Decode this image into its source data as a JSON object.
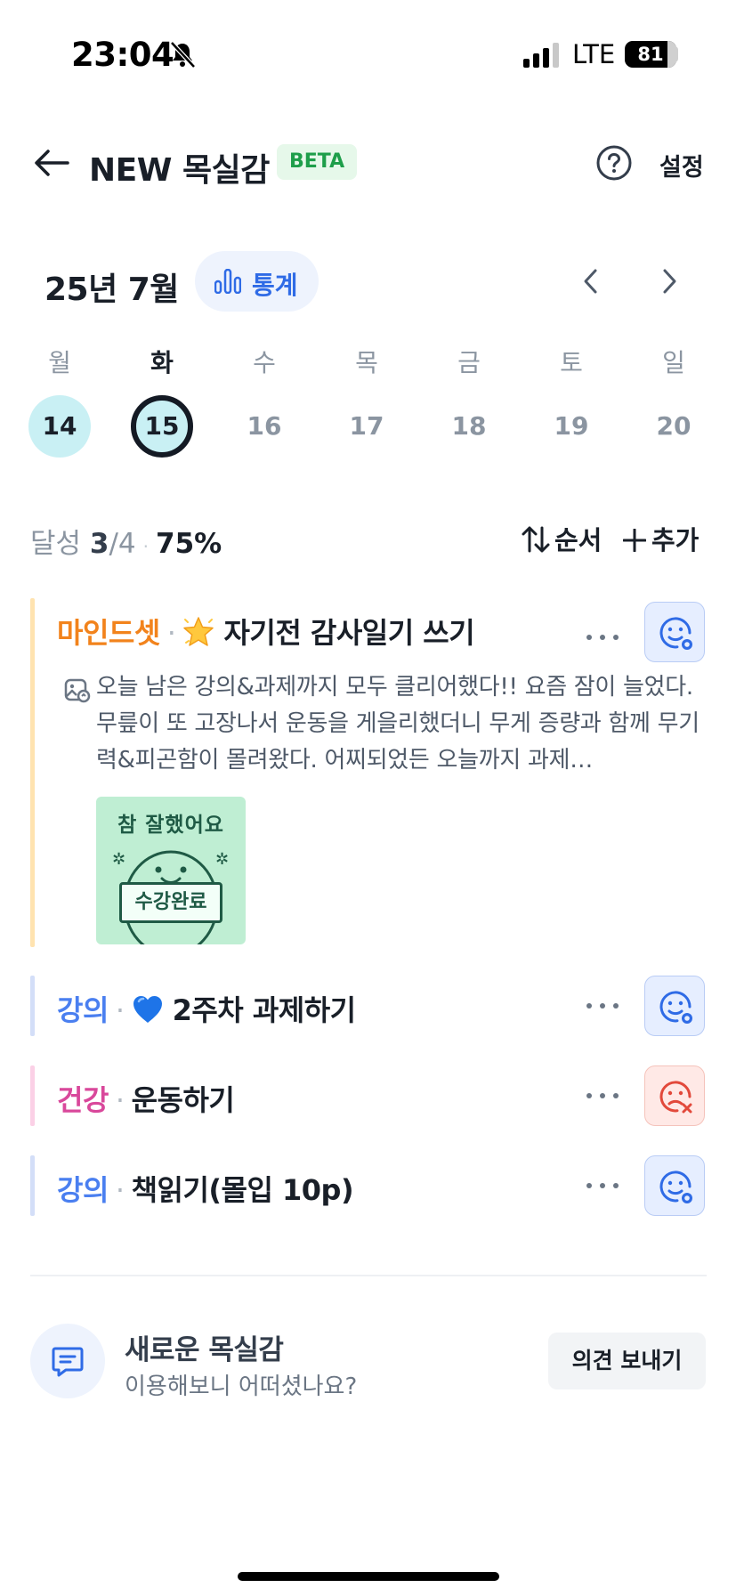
{
  "status_bar": {
    "time": "23:04",
    "network": "LTE",
    "battery": "81"
  },
  "header": {
    "title": "NEW 목실감",
    "badge": "BETA",
    "settings_label": "설정"
  },
  "calendar": {
    "month": "25년 7월",
    "stats_label": "통계",
    "weekdays": [
      "월",
      "화",
      "수",
      "목",
      "금",
      "토",
      "일"
    ],
    "dates": [
      "14",
      "15",
      "16",
      "17",
      "18",
      "19",
      "20"
    ],
    "today_index": 1,
    "done_indices": [
      0,
      1
    ]
  },
  "summary": {
    "label": "달성",
    "done": "3",
    "total": "/4",
    "percent": "75%",
    "sort_label": "순서",
    "add_label": "추가"
  },
  "tasks": [
    {
      "category": "마인드셋",
      "emoji": "star",
      "title": "자기전 감사일기 쓰기",
      "status": "success",
      "category_color": "#f2831c",
      "bar_color": "#ffe3b0",
      "memo": "오늘 남은 강의&과제까지 모두 클리어했다!! 요즘 잠이 늘었다. 무릎이 또 고장나서 운동을 게을리했더니 무게 증량과 함께 무기력&피곤함이 몰려왔다. 어찌되었든 오늘까지 과제…",
      "sticker": {
        "top_text": "참 잘했어요",
        "board_text": "수강완료"
      }
    },
    {
      "category": "강의",
      "emoji": "blue-heart",
      "title": "2주차 과제하기",
      "status": "success",
      "category_color": "#4a7ff0",
      "bar_color": "#d3def8"
    },
    {
      "category": "건강",
      "title": "운동하기",
      "status": "fail",
      "category_color": "#d9489b",
      "bar_color": "#fbd0e6"
    },
    {
      "category": "강의",
      "title": "책읽기(몰입 10p)",
      "status": "success",
      "category_color": "#4a7ff0",
      "bar_color": "#d3def8"
    }
  ],
  "feedback": {
    "title": "새로운 목실감",
    "subtitle": "이용해보니 어떠셨나요?",
    "button_label": "의견 보내기"
  },
  "colors": {
    "accent": "#2f6be6",
    "success": "#2f6be6",
    "fail": "#e2493b",
    "done_day": "#c9f0f4"
  }
}
